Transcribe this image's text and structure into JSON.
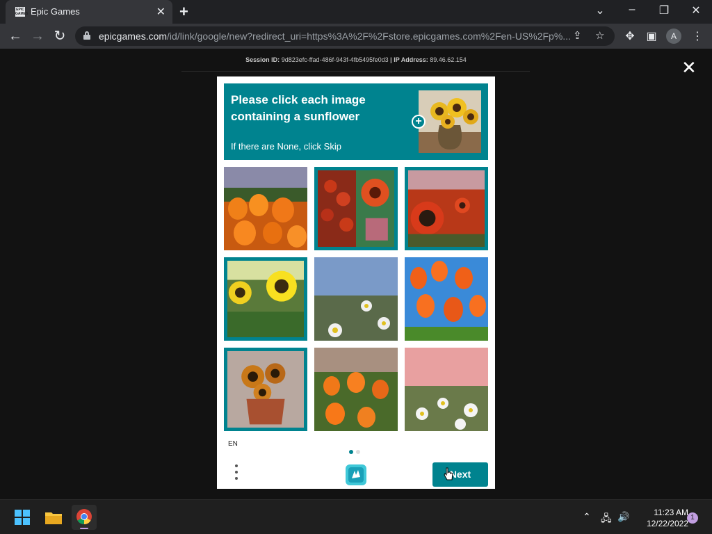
{
  "browser": {
    "tab_title": "Epic Games",
    "tab_favicon_text": "EPIC GAMES",
    "url_host": "epicgames.com",
    "url_rest": "/id/link/google/new?redirect_uri=https%3A%2F%2Fstore.epicgames.com%2Fen-US%2Fp%...",
    "profile_initial": "A",
    "icons": [
      "back-icon",
      "forward-icon",
      "reload-icon",
      "lock-icon",
      "share-icon",
      "star-icon",
      "extensions-icon",
      "side-panel-icon",
      "kebab-menu-icon"
    ]
  },
  "page": {
    "session_label": "Session ID:",
    "session_id": "9d823efc-ffad-486f-943f-4fb5495fe0d3",
    "separator": "|",
    "ip_label": "IP Address:",
    "ip": "89.46.62.154"
  },
  "captcha": {
    "prompt": "Please click each image containing a sunflower",
    "sub": "If there are None, click Skip",
    "language": "EN",
    "next_label": "Next",
    "accent": "#00838f",
    "tiles": [
      {
        "subject": "orange tulips",
        "selected": false
      },
      {
        "subject": "red sunflower",
        "selected": true
      },
      {
        "subject": "red sunflower field",
        "selected": true
      },
      {
        "subject": "yellow sunflowers",
        "selected": true
      },
      {
        "subject": "daisies",
        "selected": false
      },
      {
        "subject": "orange tulips sky",
        "selected": false
      },
      {
        "subject": "sunflowers in pot",
        "selected": true
      },
      {
        "subject": "orange tulips field",
        "selected": false
      },
      {
        "subject": "daisies sunset",
        "selected": false
      }
    ]
  },
  "taskbar": {
    "time": "11:23 AM",
    "date": "12/22/2022",
    "notifications": "1",
    "apps": [
      "windows-start-icon",
      "file-explorer-icon",
      "chrome-icon"
    ]
  }
}
